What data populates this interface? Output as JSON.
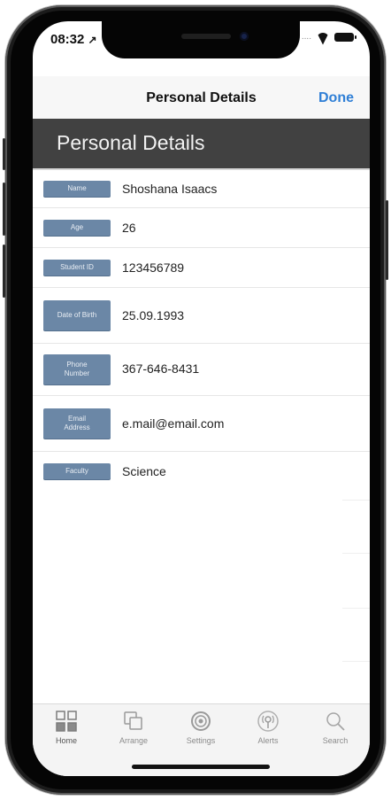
{
  "status_bar": {
    "time": "08:32",
    "location_arrow": "location-arrow-icon",
    "signal_dots": "....",
    "wifi_icon": "wifi-icon",
    "battery_icon": "battery-icon"
  },
  "nav": {
    "title": "Personal Details",
    "done_label": "Done"
  },
  "header": {
    "title": "Personal Details",
    "background": "#414141"
  },
  "fields": [
    {
      "label": "Name",
      "value": "Shoshana Isaacs"
    },
    {
      "label": "Age",
      "value": "26"
    },
    {
      "label": "Student ID",
      "value": "123456789"
    },
    {
      "label": "Date of Birth",
      "value": "25.09.1993"
    },
    {
      "label": "Phone Number",
      "value": "367-646-8431"
    },
    {
      "label": "Email Address",
      "value": "e.mail@email.com"
    },
    {
      "label": "Faculty",
      "value": "Science"
    }
  ],
  "label_color": "#6b87a6",
  "accent_color": "#2f7fd6",
  "tabs": [
    {
      "label": "Home",
      "icon": "home-grid-icon"
    },
    {
      "label": "Arrange",
      "icon": "arrange-icon"
    },
    {
      "label": "Settings",
      "icon": "settings-icon"
    },
    {
      "label": "Alerts",
      "icon": "alerts-icon"
    },
    {
      "label": "Search",
      "icon": "search-icon"
    }
  ]
}
